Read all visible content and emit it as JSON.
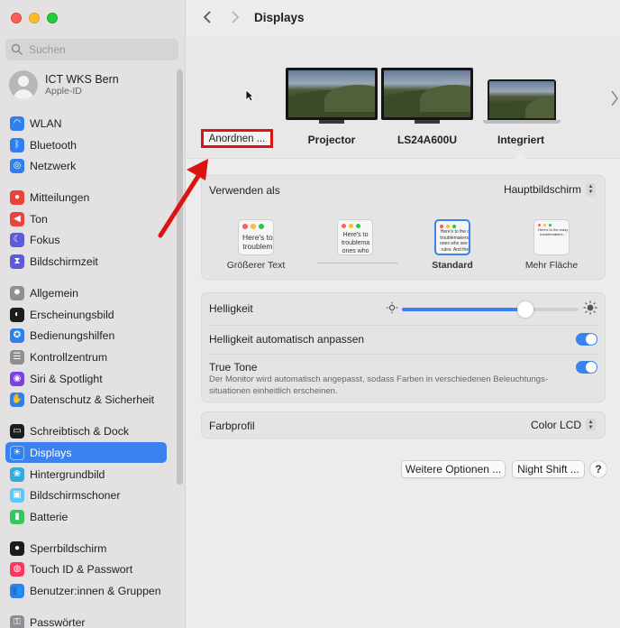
{
  "sidebar": {
    "search_placeholder": "Suchen",
    "account": {
      "name": "ICT WKS Bern",
      "subtitle": "Apple-ID"
    },
    "items": [
      {
        "label": "WLAN",
        "icon": "wifi-icon",
        "color": "#2f80ed"
      },
      {
        "label": "Bluetooth",
        "icon": "bluetooth-icon",
        "color": "#2f80ed"
      },
      {
        "label": "Netzwerk",
        "icon": "globe-icon",
        "color": "#2f80ed"
      },
      {
        "label": "Mitteilungen",
        "icon": "bell-icon",
        "color": "#e9443a"
      },
      {
        "label": "Ton",
        "icon": "speaker-icon",
        "color": "#e9443a"
      },
      {
        "label": "Fokus",
        "icon": "moon-icon",
        "color": "#5b5bd6"
      },
      {
        "label": "Bildschirmzeit",
        "icon": "hourglass-icon",
        "color": "#5b5bd6"
      },
      {
        "label": "Allgemein",
        "icon": "gear-icon",
        "color": "#8e8e93"
      },
      {
        "label": "Erscheinungsbild",
        "icon": "appearance-icon",
        "color": "#1c1c1e"
      },
      {
        "label": "Bedienungshilfen",
        "icon": "accessibility-icon",
        "color": "#2f80ed"
      },
      {
        "label": "Kontrollzentrum",
        "icon": "control-center-icon",
        "color": "#8e8e93"
      },
      {
        "label": "Siri & Spotlight",
        "icon": "siri-icon",
        "color": "#7b3fe4"
      },
      {
        "label": "Datenschutz & Sicherheit",
        "icon": "hand-icon",
        "color": "#2f80ed"
      },
      {
        "label": "Schreibtisch & Dock",
        "icon": "dock-icon",
        "color": "#1c1c1e"
      },
      {
        "label": "Displays",
        "icon": "sun-icon",
        "color": "#2f80ed"
      },
      {
        "label": "Hintergrundbild",
        "icon": "flower-icon",
        "color": "#35aadc"
      },
      {
        "label": "Bildschirmschoner",
        "icon": "screensaver-icon",
        "color": "#5ac8fa"
      },
      {
        "label": "Batterie",
        "icon": "battery-icon",
        "color": "#34c759"
      },
      {
        "label": "Sperrbildschirm",
        "icon": "lock-icon",
        "color": "#1c1c1e"
      },
      {
        "label": "Touch ID & Passwort",
        "icon": "fingerprint-icon",
        "color": "#ff375f"
      },
      {
        "label": "Benutzer:innen & Gruppen",
        "icon": "users-icon",
        "color": "#2f80ed"
      },
      {
        "label": "Passwörter",
        "icon": "key-icon",
        "color": "#8e8e93"
      }
    ],
    "active_item": "Displays"
  },
  "toolbar": {
    "title": "Displays"
  },
  "displays": {
    "arrange_label": "Anordnen ...",
    "monitors": [
      {
        "label": "Projector"
      },
      {
        "label": "LS24A600U"
      },
      {
        "label": "Integriert"
      }
    ]
  },
  "use_as": {
    "label": "Verwenden als",
    "value": "Hauptbildschirm",
    "resolutions": [
      {
        "label": "Größerer Text",
        "preview": "Here's to\ntroublem"
      },
      {
        "label": "",
        "preview": "Here's to\ntroublema\nones who"
      },
      {
        "label": "Standard",
        "preview": "Here's to the c\ntroublemakers.\nones who see t\nrules. And the"
      },
      {
        "label": "Mehr Fläche",
        "preview": "Here's to the crazy\ntroublemakers..."
      }
    ],
    "selected_resolution": "Standard"
  },
  "brightness": {
    "label": "Helligkeit",
    "level": 0.7,
    "auto_label": "Helligkeit automatisch anpassen",
    "auto_on": true,
    "true_tone_label": "True Tone",
    "true_tone_on": true,
    "true_tone_desc": "Der Monitor wird automatisch angepasst, sodass Farben in verschiedenen Beleuchtungs-situationen einheitlich erscheinen."
  },
  "color_profile": {
    "label": "Farbprofil",
    "value": "Color LCD"
  },
  "buttons": {
    "more_options": "Weitere Optionen ...",
    "night_shift": "Night Shift ...",
    "help": "?"
  },
  "colors": {
    "accent": "#3b82f0",
    "highlight_box": "#dd1212",
    "arrow": "#dd1212"
  }
}
